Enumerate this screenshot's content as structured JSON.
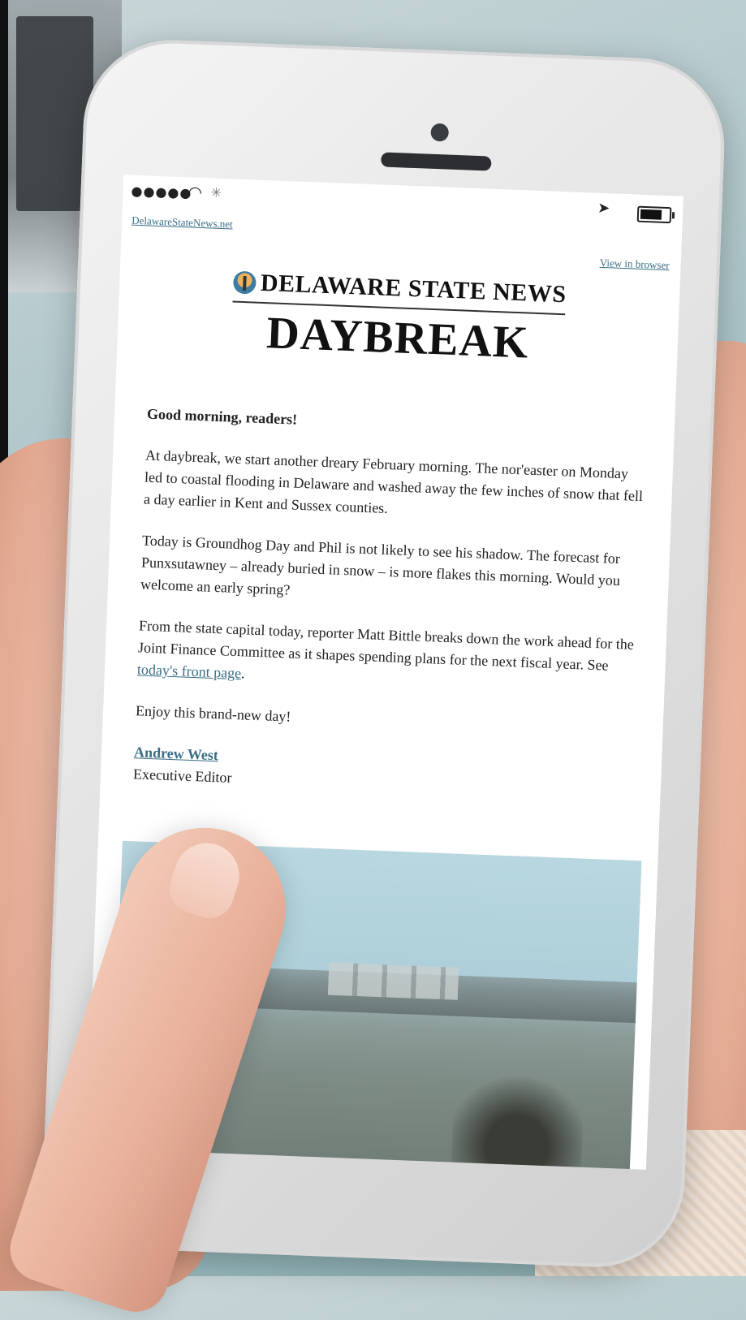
{
  "status": {
    "signal": "●●●●●",
    "wifi_icon": "wifi-icon",
    "activity_icon": "activity-spinner-icon",
    "location_icon": "location-arrow-icon",
    "battery_icon": "battery-icon"
  },
  "email": {
    "site_link": "DelawareStateNews.net",
    "view_in_browser": "View in browser",
    "brand": "DELAWARE STATE NEWS",
    "newsletter": "DAYBREAK",
    "greeting": "Good morning, readers!",
    "para1": "At daybreak, we start another dreary February morning. The nor'easter on Monday led to coastal flooding in Delaware and washed away the few inches of snow that fell a day earlier in Kent and Sussex counties.",
    "para2": "Today is Groundhog Day and Phil is not likely to see his shadow. The forecast for Punxsutawney – already buried in snow – is more flakes this morning. Would you welcome an early spring?",
    "para3_before": "From the state capital today, reporter Matt Bittle breaks down the work ahead for the Joint Finance Committee as it shapes spending plans for the next fiscal year. See ",
    "para3_link": "today's front page",
    "para3_after": ".",
    "closing": "Enjoy this brand-new day!",
    "signature_name": "Andrew West",
    "signature_title": "Executive Editor"
  },
  "colors": {
    "link": "#3a6e86",
    "text": "#222222",
    "background": "#ffffff"
  }
}
